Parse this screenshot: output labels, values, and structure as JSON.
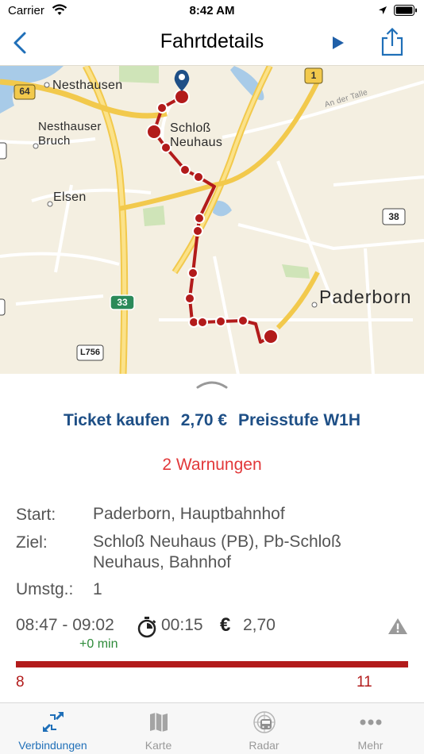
{
  "status_bar": {
    "carrier": "Carrier",
    "time": "8:42 AM"
  },
  "nav": {
    "title": "Fahrtdetails",
    "back_icon": "chevron-left-icon",
    "play_icon": "play-icon",
    "share_icon": "share-icon",
    "accent_color": "#1f6fb8"
  },
  "map": {
    "places": [
      "Nesthausen",
      "Nesthauser",
      "Bruch",
      "Schloß",
      "Neuhaus",
      "Elsen",
      "Paderborn"
    ],
    "road_badges": [
      "64",
      "1",
      "38",
      "33",
      "L756"
    ],
    "street": "An der Talle",
    "route_color": "#b21b1b"
  },
  "ticket": {
    "label": "Ticket kaufen",
    "price": "2,70 €",
    "tariff": "Preisstufe W1H"
  },
  "warnings": "2 Warnungen",
  "details": {
    "start_label": "Start:",
    "start_value": "Paderborn, Hauptbahnhof",
    "ziel_label": "Ziel:",
    "ziel_value": "Schloß Neuhaus (PB), Pb-Schloß Neuhaus, Bahnhof",
    "umstieg_label": "Umstg.:",
    "umstieg_value": "1"
  },
  "trip": {
    "times": "08:47 - 09:02",
    "delay": "+0 min",
    "duration": "00:15",
    "currency_symbol": "€",
    "price": "2,70"
  },
  "line": {
    "start": "8",
    "end": "11",
    "color": "#b21b1b"
  },
  "tabs": [
    {
      "label": "Verbindungen",
      "icon": "connections-icon",
      "active": true
    },
    {
      "label": "Karte",
      "icon": "map-icon",
      "active": false
    },
    {
      "label": "Radar",
      "icon": "radar-icon",
      "active": false
    },
    {
      "label": "Mehr",
      "icon": "more-icon",
      "active": false
    }
  ]
}
